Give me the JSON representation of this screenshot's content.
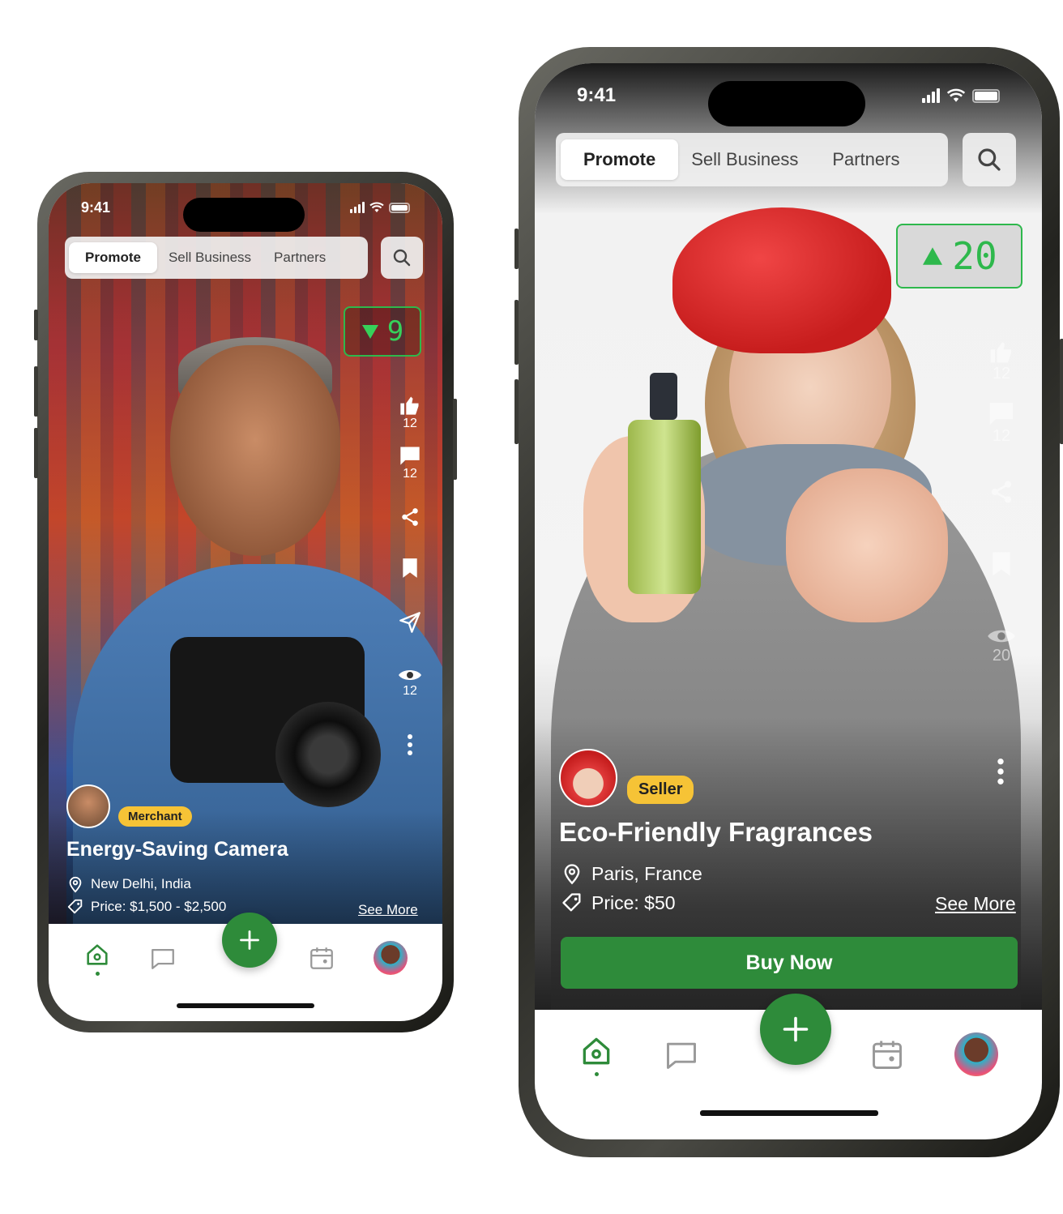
{
  "phones": [
    {
      "status": {
        "time": "9:41"
      },
      "tabs": [
        {
          "label": "Promote",
          "active": true
        },
        {
          "label": "Sell Business"
        },
        {
          "label": "Partners"
        }
      ],
      "score": {
        "direction": "down",
        "value": "9",
        "color": "#36d15a"
      },
      "rail": {
        "likes": "12",
        "comments": "12",
        "views": "12"
      },
      "post": {
        "badge": "Merchant",
        "title": "Energy-Saving Camera",
        "location": "New Delhi, India",
        "price": "Price: $1,500 - $2,500",
        "see_more": "See More"
      }
    },
    {
      "status": {
        "time": "9:41"
      },
      "tabs": [
        {
          "label": "Promote",
          "active": true
        },
        {
          "label": "Sell Business"
        },
        {
          "label": "Partners"
        }
      ],
      "score": {
        "direction": "up",
        "value": "20",
        "color": "#36d15a"
      },
      "rail": {
        "likes": "12",
        "comments": "12",
        "views": "20"
      },
      "post": {
        "badge": "Seller",
        "title": "Eco-Friendly Fragrances",
        "location": "Paris, France",
        "price": "Price: $50",
        "see_more": "See More"
      },
      "buy_label": "Buy Now"
    }
  ],
  "colors": {
    "accent": "#2e8b3a",
    "badge": "#f6c336",
    "score_border": "#2eb84c"
  },
  "icons": [
    "search-icon",
    "thumbs-up-icon",
    "comment-icon",
    "share-icon",
    "bookmark-icon",
    "send-icon",
    "eye-icon",
    "more-icon",
    "location-icon",
    "price-tag-icon",
    "home-icon",
    "chat-icon",
    "plus-icon",
    "calendar-icon"
  ]
}
